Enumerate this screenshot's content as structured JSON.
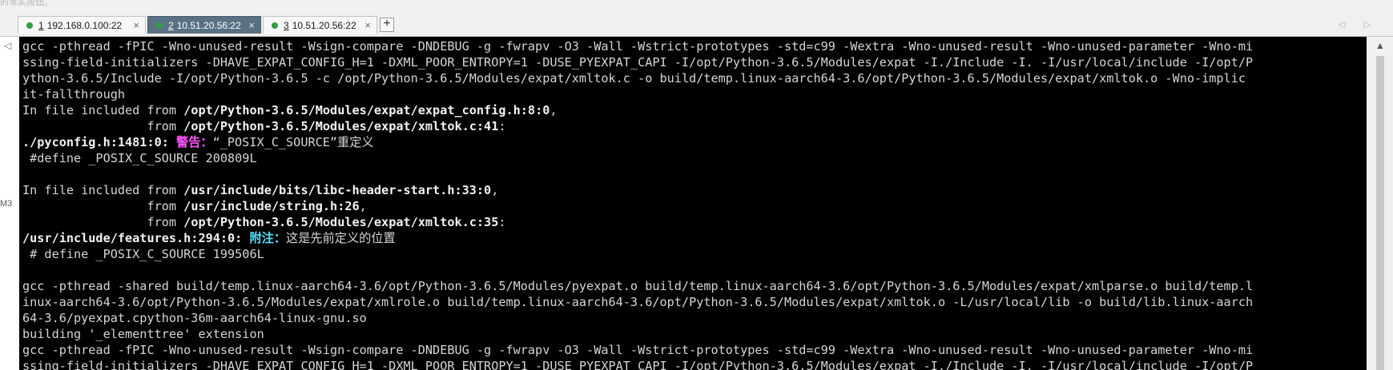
{
  "top_hint": "的常实按钮。",
  "tabs": [
    {
      "number": "1",
      "host": "192.168.0.100:22",
      "active": false
    },
    {
      "number": "2",
      "host": "10.51.20.56:22",
      "active": true
    },
    {
      "number": "3",
      "host": "10.51.20.56:22",
      "active": false
    }
  ],
  "tab_close_glyph": "×",
  "add_tab_glyph": "+",
  "nav_arrows": "◁ ▷",
  "gutter": {
    "arrow": "◁",
    "label": "M3"
  },
  "scrollbar": {
    "up_arrow": "▲"
  },
  "terminal": {
    "lines": [
      [
        {
          "t": "gcc -pthread -fPIC -Wno-unused-result -Wsign-compare -DNDEBUG -g -fwrapv -O3 -Wall -Wstrict-prototypes -std=c99 -Wextra -Wno-unused-result -Wno-unused-parameter -Wno-mi"
        }
      ],
      [
        {
          "t": "ssing-field-initializers -DHAVE_EXPAT_CONFIG_H=1 -DXML_POOR_ENTROPY=1 -DUSE_PYEXPAT_CAPI -I/opt/Python-3.6.5/Modules/expat -I./Include -I. -I/usr/local/include -I/opt/P"
        }
      ],
      [
        {
          "t": "ython-3.6.5/Include -I/opt/Python-3.6.5 -c /opt/Python-3.6.5/Modules/expat/xmltok.c -o build/temp.linux-aarch64-3.6/opt/Python-3.6.5/Modules/expat/xmltok.o -Wno-implic"
        }
      ],
      [
        {
          "t": "it-fallthrough"
        }
      ],
      [
        {
          "t": "In file included from "
        },
        {
          "t": "/opt/Python-3.6.5/Modules/expat/expat_config.h:8:0",
          "s": "b"
        },
        {
          "t": ","
        }
      ],
      [
        {
          "t": "                 from "
        },
        {
          "t": "/opt/Python-3.6.5/Modules/expat/xmltok.c:41",
          "s": "b"
        },
        {
          "t": ":"
        }
      ],
      [
        {
          "t": "./pyconfig.h:1481:0:",
          "s": "b"
        },
        {
          "t": " "
        },
        {
          "t": "警告：",
          "s": "w"
        },
        {
          "t": "“_POSIX_C_SOURCE”重定义"
        }
      ],
      [
        {
          "t": " #define _POSIX_C_SOURCE 200809L"
        }
      ],
      [
        {
          "t": ""
        }
      ],
      [
        {
          "t": "In file included from "
        },
        {
          "t": "/usr/include/bits/libc-header-start.h:33:0",
          "s": "b"
        },
        {
          "t": ","
        }
      ],
      [
        {
          "t": "                 from "
        },
        {
          "t": "/usr/include/string.h:26",
          "s": "b"
        },
        {
          "t": ","
        }
      ],
      [
        {
          "t": "                 from "
        },
        {
          "t": "/opt/Python-3.6.5/Modules/expat/xmltok.c:35",
          "s": "b"
        },
        {
          "t": ":"
        }
      ],
      [
        {
          "t": "/usr/include/features.h:294:0:",
          "s": "b"
        },
        {
          "t": " "
        },
        {
          "t": "附注：",
          "s": "n"
        },
        {
          "t": "这是先前定义的位置"
        }
      ],
      [
        {
          "t": " # define _POSIX_C_SOURCE 199506L"
        }
      ],
      [
        {
          "t": ""
        }
      ],
      [
        {
          "t": "gcc -pthread -shared build/temp.linux-aarch64-3.6/opt/Python-3.6.5/Modules/pyexpat.o build/temp.linux-aarch64-3.6/opt/Python-3.6.5/Modules/expat/xmlparse.o build/temp.l"
        }
      ],
      [
        {
          "t": "inux-aarch64-3.6/opt/Python-3.6.5/Modules/expat/xmlrole.o build/temp.linux-aarch64-3.6/opt/Python-3.6.5/Modules/expat/xmltok.o -L/usr/local/lib -o build/lib.linux-aarch"
        }
      ],
      [
        {
          "t": "64-3.6/pyexpat.cpython-36m-aarch64-linux-gnu.so"
        }
      ],
      [
        {
          "t": "building '_elementtree' extension"
        }
      ],
      [
        {
          "t": "gcc -pthread -fPIC -Wno-unused-result -Wsign-compare -DNDEBUG -g -fwrapv -O3 -Wall -Wstrict-prototypes -std=c99 -Wextra -Wno-unused-result -Wno-unused-parameter -Wno-mi"
        }
      ],
      [
        {
          "t": "ssing-field-initializers -DHAVE_EXPAT_CONFIG_H=1 -DXML_POOR_ENTROPY=1 -DUSE_PYEXPAT_CAPI -I/opt/Python-3.6.5/Modules/expat -I./Include -I. -I/usr/local/include -I/opt/P"
        }
      ]
    ]
  }
}
